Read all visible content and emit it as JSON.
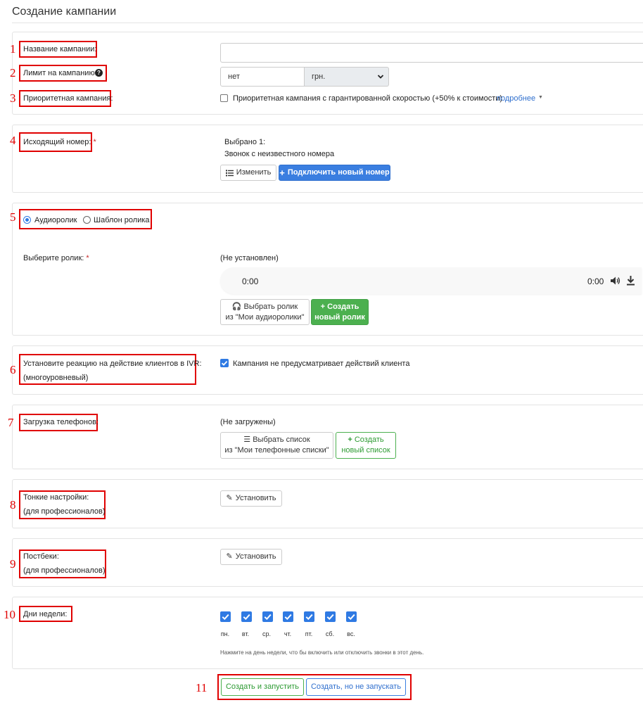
{
  "page": {
    "title": "Создание кампании"
  },
  "annotations": [
    "1",
    "2",
    "3",
    "4",
    "5",
    "6",
    "7",
    "8",
    "9",
    "10",
    "11"
  ],
  "campaign": {
    "name_label": "Название кампании:",
    "name_value": "",
    "limit_label": "Лимит на кампанию:",
    "limit_value": "нет",
    "currency": "грн.",
    "priority_label": "Приоритетная кампания:",
    "priority_checkbox_label": "Приоритетная кампания с гарантированной скоростью (+50% к стоимости)",
    "priority_more_link": "подробнее",
    "priority_checked": false
  },
  "outgoing": {
    "label": "Исходящий номер:",
    "selected_count": "Выбрано 1:",
    "selected_value": "Звонок с неизвестного номера",
    "change_button": "Изменить",
    "connect_button": "Подключить новый номер"
  },
  "audio": {
    "radio_audio": "Аудиоролик",
    "radio_template": "Шаблон ролика",
    "selected_radio": "audio",
    "choose_label": "Выберите ролик:",
    "status": "(Не установлен)",
    "time_current": "0:00",
    "time_total": "0:00",
    "choose_button_line1": "Выбрать ролик",
    "choose_button_line2": "из \"Мои аудиоролики\"",
    "create_button_line1": "Создать",
    "create_button_line2": "новый ролик"
  },
  "ivr": {
    "label_line1": "Установите реакцию на действие клиентов в IVR:",
    "label_line2": "(многоуровневый)",
    "checkbox_label": "Кампания не предусматривает действий клиента",
    "checked": true
  },
  "phones": {
    "label": "Загрузка телефонов:",
    "status": "(Не загружены)",
    "choose_button_line1": "Выбрать список",
    "choose_button_line2": "из \"Мои телефонные списки\"",
    "create_button_line1": "Создать",
    "create_button_line2": "новый список"
  },
  "fine_settings": {
    "label_line1": "Тонкие настройки:",
    "label_line2": "(для профессионалов)",
    "button": "Установить"
  },
  "postbacks": {
    "label_line1": "Постбеки:",
    "label_line2": "(для профессионалов)",
    "button": "Установить"
  },
  "weekdays": {
    "label": "Дни недели:",
    "days": [
      "пн.",
      "вт.",
      "ср.",
      "чт.",
      "пт.",
      "сб.",
      "вс."
    ],
    "checked": [
      true,
      true,
      true,
      true,
      true,
      true,
      true
    ],
    "hint": "Нажмите на день недели, что бы включить или отключить звонки в этот день."
  },
  "actions": {
    "create_and_start": "Создать и запустить",
    "create_no_start": "Создать, но не запускать"
  },
  "colors": {
    "accent_blue": "#3a7ee0",
    "accent_green": "#4cb04f",
    "annotation_red": "#e00000",
    "required_red": "#c62828"
  }
}
